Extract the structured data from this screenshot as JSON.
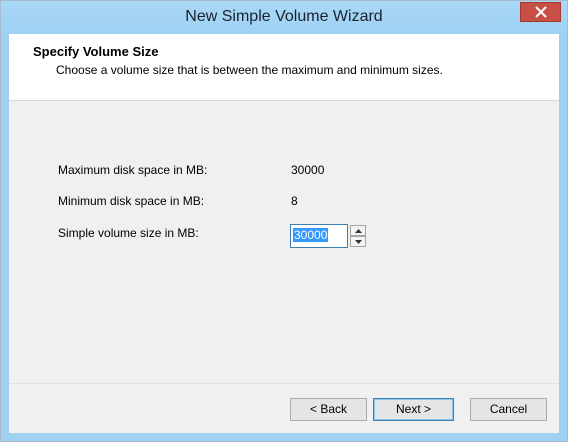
{
  "window": {
    "title": "New Simple Volume Wizard"
  },
  "header": {
    "title": "Specify Volume Size",
    "subtitle": "Choose a volume size that is between the maximum and minimum sizes."
  },
  "fields": {
    "max_label": "Maximum disk space in MB:",
    "max_value": "30000",
    "min_label": "Minimum disk space in MB:",
    "min_value": "8",
    "size_label": "Simple volume size in MB:",
    "size_value": "30000"
  },
  "buttons": {
    "back": "< Back",
    "next": "Next >",
    "cancel": "Cancel"
  },
  "colors": {
    "titlebar": "#9fd1f3",
    "close": "#c74f45",
    "selection": "#3399ff"
  },
  "icons": {
    "close": "close-icon",
    "spin_up": "chevron-up-icon",
    "spin_down": "chevron-down-icon"
  }
}
